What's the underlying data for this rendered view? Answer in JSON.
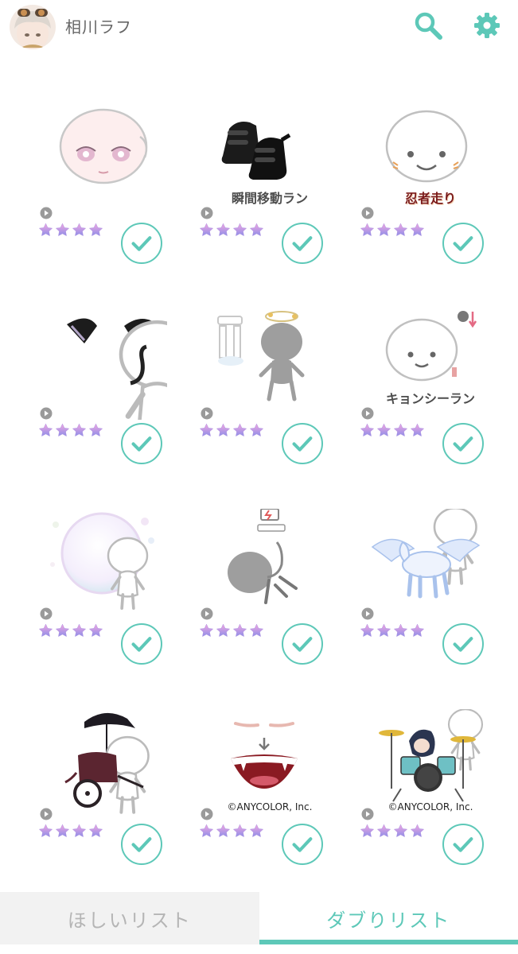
{
  "header": {
    "username": "相川ラフ",
    "icons": [
      "search-icon",
      "gear-icon"
    ]
  },
  "accent_color": "#5dc8b8",
  "items": [
    {
      "caption": "",
      "rarity": 4,
      "checked": true
    },
    {
      "caption": "瞬間移動ラン",
      "rarity": 4,
      "checked": true
    },
    {
      "caption": "忍者走り",
      "rarity": 4,
      "checked": true
    },
    {
      "caption": "",
      "rarity": 4,
      "checked": true
    },
    {
      "caption": "",
      "rarity": 4,
      "checked": true
    },
    {
      "caption": "キョンシーラン",
      "rarity": 4,
      "checked": true
    },
    {
      "caption": "",
      "rarity": 4,
      "checked": true
    },
    {
      "caption": "",
      "rarity": 4,
      "checked": true
    },
    {
      "caption": "",
      "rarity": 4,
      "checked": true
    },
    {
      "caption": "",
      "rarity": 4,
      "checked": true
    },
    {
      "caption": "©ANYCOLOR, Inc.",
      "rarity": 4,
      "checked": true
    },
    {
      "caption": "©ANYCOLOR, Inc.",
      "rarity": 4,
      "checked": true
    }
  ],
  "tabs": {
    "wishlist": "ほしいリスト",
    "duplicates": "ダブりリスト",
    "active": "duplicates"
  }
}
